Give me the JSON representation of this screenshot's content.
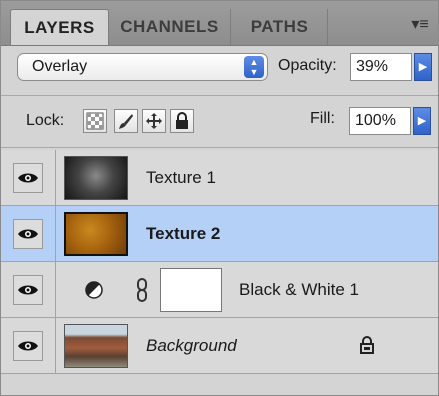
{
  "tabs": [
    {
      "label": "LAYERS",
      "active": true
    },
    {
      "label": "CHANNELS",
      "active": false
    },
    {
      "label": "PATHS",
      "active": false
    }
  ],
  "blend_mode": "Overlay",
  "opacity": {
    "label": "Opacity:",
    "value": "39%"
  },
  "lock": {
    "label": "Lock:",
    "icons": [
      "lock-transparent-pixels-icon",
      "lock-image-pixels-icon",
      "lock-position-icon",
      "lock-all-icon"
    ]
  },
  "fill": {
    "label": "Fill:",
    "value": "100%"
  },
  "layers": [
    {
      "name": "Texture 1",
      "selected": false,
      "visible": true
    },
    {
      "name": "Texture 2",
      "selected": true,
      "visible": true
    },
    {
      "name": "Black & White 1",
      "selected": false,
      "visible": true,
      "adjustment": true
    },
    {
      "name": "Background",
      "selected": false,
      "visible": true,
      "locked": true,
      "italic": true
    }
  ],
  "colors": {
    "selected_row": "#b4d0f7",
    "accent_blue": "#2f62c8",
    "panel_bg": "#d4d4d4"
  }
}
